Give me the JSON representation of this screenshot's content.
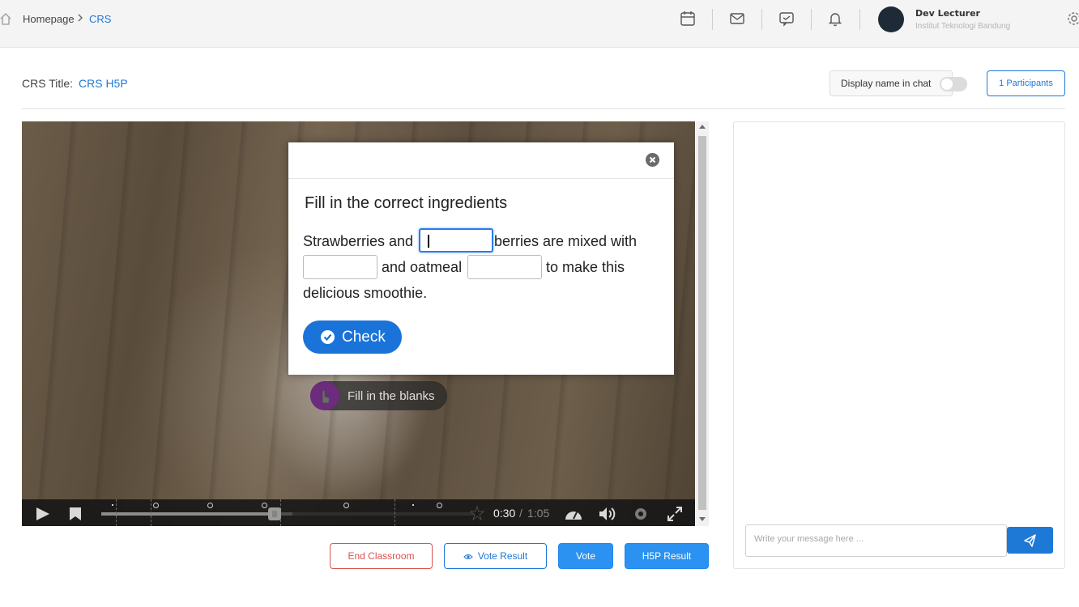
{
  "header": {
    "breadcrumb": {
      "home": "Homepage",
      "current": "CRS"
    },
    "user": {
      "name": "Dev Lecturer",
      "organization": "Institut Teknologi Bandung"
    },
    "icons": [
      "home-icon",
      "calendar-icon",
      "mail-icon",
      "chat-icon",
      "bell-icon",
      "gear-icon"
    ]
  },
  "title_row": {
    "crs_label": "CRS Title:",
    "crs_value": "CRS H5P",
    "display_name_label": "Display name in chat",
    "display_name_enabled": false,
    "participants_button": "1 Participants"
  },
  "video": {
    "current_time": "0:30",
    "time_separator": "/",
    "duration": "1:05",
    "progress_fraction": 0.46,
    "interaction_label": "Fill in the blanks"
  },
  "dialog": {
    "title": "Fill in the correct ingredients",
    "text": {
      "part1": "Strawberries and",
      "part2": "berries are mixed with",
      "part3": "and oatmeal",
      "part4": "to make this",
      "part5": "delicious smoothie."
    },
    "check_button": "Check"
  },
  "actions": {
    "end_classroom": "End Classroom",
    "vote_result": "Vote Result",
    "vote": "Vote",
    "h5p_result": "H5P Result"
  },
  "chat": {
    "placeholder": "Write your message here ..."
  },
  "colors": {
    "accent": "#1e78d6",
    "danger": "#d9534f",
    "check_button": "#1a73d9",
    "interaction_icon": "#6c2b7d"
  }
}
